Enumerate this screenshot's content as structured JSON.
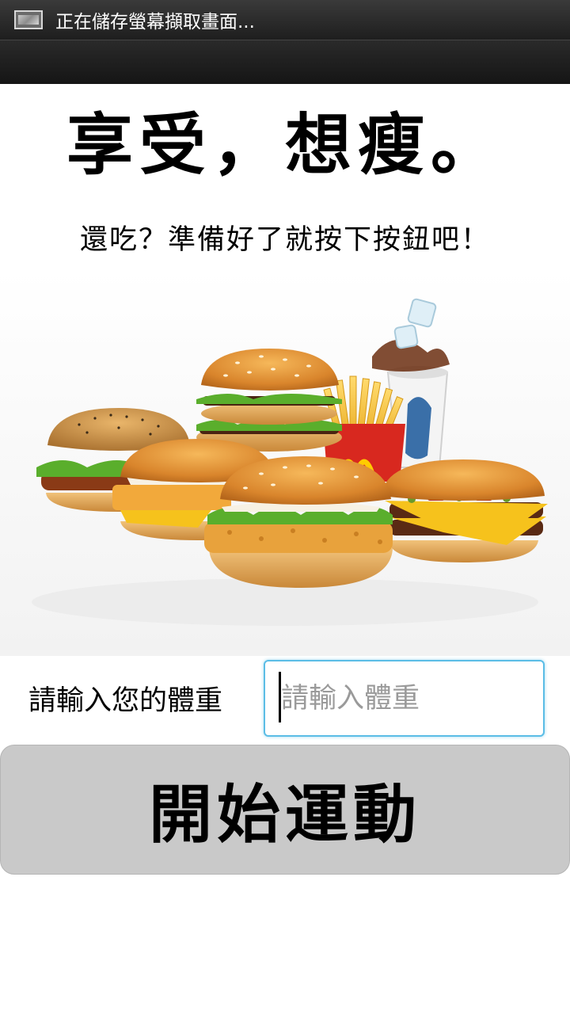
{
  "status_bar": {
    "icon": "screenshot-icon",
    "text": "正在儲存螢幕擷取畫面..."
  },
  "main": {
    "title": "享受，想瘦。",
    "subtitle": "還吃？準備好了就按下按鈕吧！",
    "image": {
      "icon": "fast-food-image"
    },
    "weight": {
      "label": "請輸入您的體重",
      "value": "",
      "placeholder": "請輸入體重"
    },
    "start_button_label": "開始運動"
  },
  "colors": {
    "status_bar": "#1e1e1e",
    "input_border": "#5bbde6",
    "button_background": "#c9c9c9",
    "bun": "#e59a3a",
    "lettuce": "#5aae2c",
    "cheese": "#f6c21c",
    "fries_box": "#d8281f",
    "arches": "#ffcc00"
  }
}
